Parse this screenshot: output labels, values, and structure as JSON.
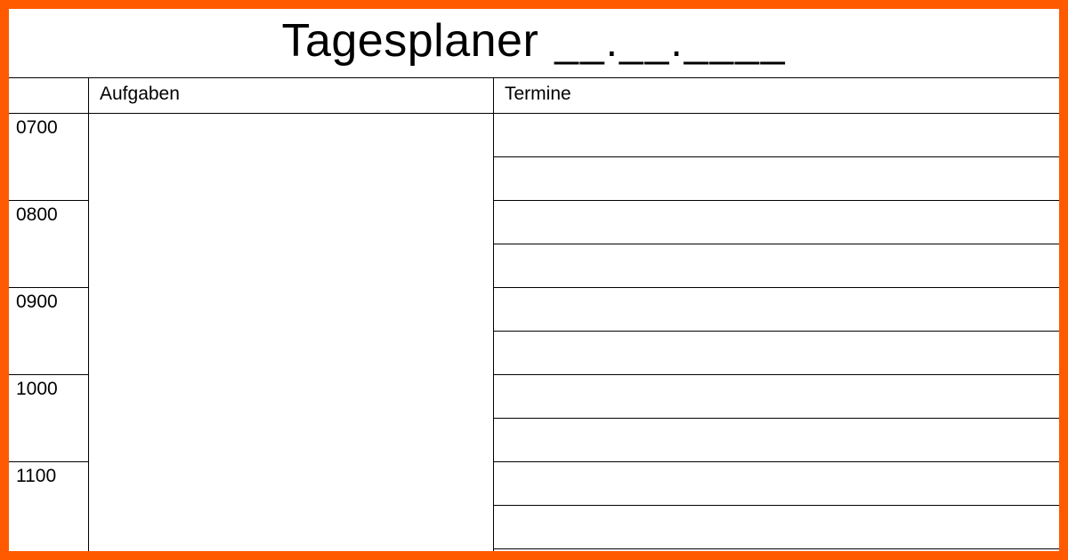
{
  "title": "Tagesplaner",
  "date_placeholder": "__.__.____",
  "columns": {
    "tasks": "Aufgaben",
    "appointments": "Termine"
  },
  "hours": [
    "0700",
    "0800",
    "0900",
    "1000",
    "1100"
  ],
  "colors": {
    "frame": "#ff5a00",
    "text": "#000000",
    "background": "#ffffff"
  }
}
